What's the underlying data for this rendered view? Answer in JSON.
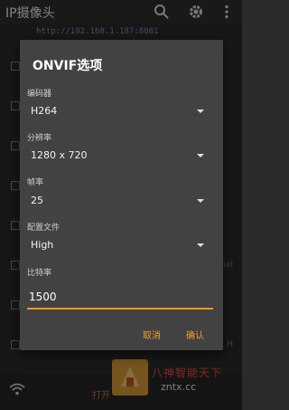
{
  "app": {
    "title": "IP摄像头",
    "url": "http://192.168.1.187:8081",
    "right_fragments": [
      "",
      "",
      "",
      "",
      "",
      "",
      "nel",
      "",
      "H"
    ],
    "start_label": "打开"
  },
  "watermark": {
    "line1": "八神智能天下",
    "line2": "zntx.cc"
  },
  "dialog": {
    "title": "ONVIF选项",
    "fields": {
      "encoder": {
        "label": "编码器",
        "value": "H264"
      },
      "resolution": {
        "label": "分辨率",
        "value": "1280 x 720"
      },
      "framerate": {
        "label": "帧率",
        "value": "25"
      },
      "profile": {
        "label": "配置文件",
        "value": "High"
      },
      "bitrate": {
        "label": "比特率",
        "value": "1500"
      }
    },
    "cancel_label": "取消",
    "ok_label": "确认"
  },
  "colors": {
    "accent": "#ef9b21",
    "dialog_bg": "#424242",
    "background": "#2b2b2b"
  }
}
